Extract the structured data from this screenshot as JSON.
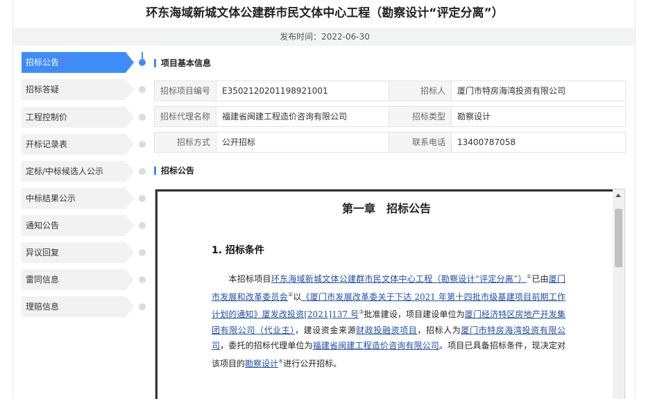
{
  "page": {
    "title": "环东海域新城文体公建群市民文体中心工程（勘察设计“评定分离”）",
    "publish_label": "发布时间：2022-06-30"
  },
  "sidebar": {
    "items": [
      {
        "label": "招标公告",
        "required": "*"
      },
      {
        "label": "招标答疑"
      },
      {
        "label": "工程控制价"
      },
      {
        "label": "开标记录表"
      },
      {
        "label": "定标/中标候选人公示"
      },
      {
        "label": "中标结果公示"
      },
      {
        "label": "通知公告"
      },
      {
        "label": "异议回复"
      },
      {
        "label": "雷同信息"
      },
      {
        "label": "理赔信息"
      }
    ]
  },
  "sections": {
    "basic_info": "项目基本信息",
    "notice": "招标公告"
  },
  "info": {
    "rows": [
      {
        "l1": "招标项目编号",
        "v1": "E3502120201198921001",
        "l2": "招标人",
        "v2": "厦门市特房海湾投资有限公司"
      },
      {
        "l1": "招标代理名称",
        "v1": "福建省闽建工程造价咨询有限公司",
        "l2": "招标类型",
        "v2": "勘察设计"
      },
      {
        "l1": "招标方式",
        "v1": "公开招标",
        "l2": "联系电话",
        "v2": "13400787058"
      }
    ]
  },
  "document": {
    "chapter_no": "第一章",
    "chapter_title": "招标公告",
    "heading": "1. 招标条件",
    "p": {
      "t1": "本招标项目",
      "u1": "环东海域新城文体公建群市民文体中心工程（勘察设计“评定分离”）",
      "s1": "①",
      "t2": "已由",
      "u2": "厦门市发展和改革委员会",
      "s2": "②",
      "t3": "以",
      "u3": "《厦门市发展改革委关于下达 2021 年第十四批市级基建项目前期工作计划的通知》厦发改投资[2021]137 号",
      "s3": "③",
      "t4": "批准建设，项目建设单位为",
      "u4": "厦门经济特区房地产开发集团有限公司（代业主）",
      "t5": "，建设资金来源",
      "u5": "财政投融资项目",
      "t6": "，招标人为",
      "u6": "厦门市特房海湾投资有限公司",
      "t7": "，委托的招标代理单位为",
      "u7": "福建省闽建工程造价咨询有限公司",
      "t8": "。项目已具备招标条件，现决定对该项目的",
      "u8": "勘察设计",
      "s4": "④",
      "t9": "进行公开招标。"
    }
  }
}
